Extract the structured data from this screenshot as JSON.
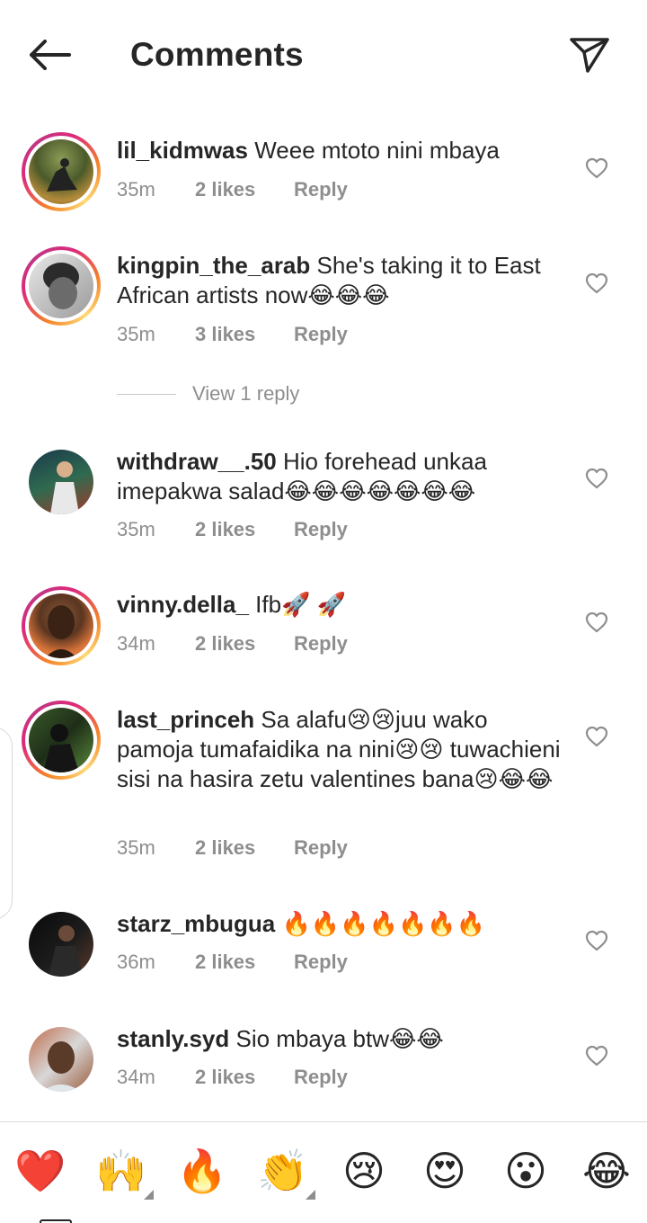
{
  "header": {
    "title": "Comments",
    "back_icon": "arrow-left-icon",
    "send_icon": "paper-plane-icon"
  },
  "reply_label": "Reply",
  "comments": [
    {
      "username": "lil_kidmwas",
      "text": "Weee mtoto nini mbaya",
      "time": "35m",
      "likes": "2 likes",
      "story_ring": true
    },
    {
      "username": "kingpin_the_arab",
      "text": "She's taking it to East African artists now😂😂😂",
      "time": "35m",
      "likes": "3 likes",
      "story_ring": true
    },
    {
      "username": "withdraw__.50",
      "text": "Hio forehead unkaa imepakwa salad😂😂😂😂😂😂😂",
      "time": "35m",
      "likes": "2 likes",
      "story_ring": false
    },
    {
      "username": "vinny.della_",
      "text": "Ifb🚀 🚀",
      "time": "34m",
      "likes": "2 likes",
      "story_ring": true
    },
    {
      "username": "last_princeh",
      "text": "Sa alafu😢😢juu wako pamoja tumafaidika na nini😢😢 tuwachieni sisi na hasira zetu valentines bana😢😂😂",
      "time": "35m",
      "likes": "2 likes",
      "story_ring": true
    },
    {
      "username": "starz_mbugua",
      "text": "🔥🔥🔥🔥🔥🔥🔥",
      "time": "36m",
      "likes": "2 likes",
      "story_ring": false
    },
    {
      "username": "stanly.syd",
      "text": "Sio mbaya btw😂😂",
      "time": "34m",
      "likes": "2 likes",
      "story_ring": false
    }
  ],
  "view_replies": "View 1 reply",
  "emoji_bar": [
    "❤️",
    "🙌",
    "🔥",
    "👏",
    "😢",
    "😍",
    "😮",
    "😂"
  ],
  "colors": {
    "text": "#262626",
    "secondary": "#8e8e8e",
    "story_ring_start": "#f58529",
    "story_ring_end": "#dd2a7b"
  }
}
